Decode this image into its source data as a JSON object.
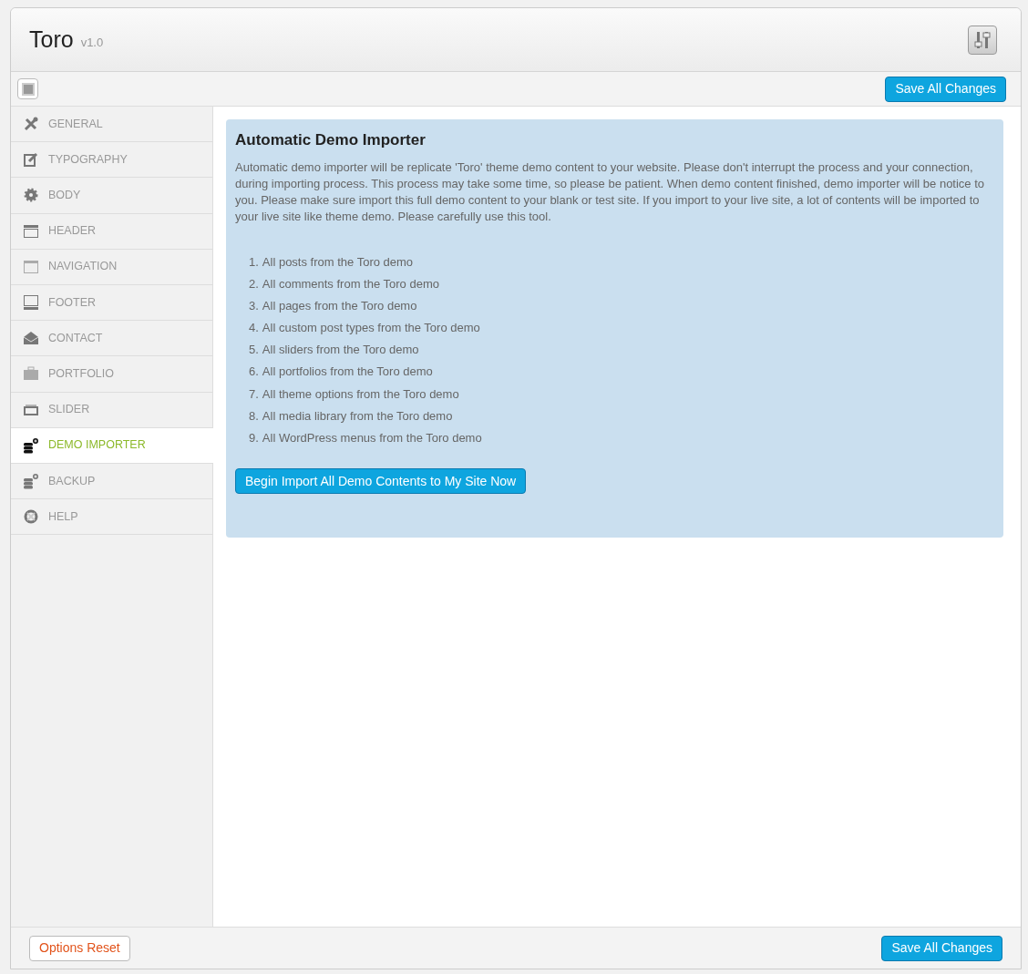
{
  "header": {
    "title": "Toro",
    "version": "v1.0"
  },
  "toolbar": {
    "save_button": "Save All Changes"
  },
  "sidebar": {
    "items": [
      {
        "label": "GENERAL",
        "selected": false
      },
      {
        "label": "TYPOGRAPHY",
        "selected": false
      },
      {
        "label": "BODY",
        "selected": false
      },
      {
        "label": "HEADER",
        "selected": false
      },
      {
        "label": "NAVIGATION",
        "selected": false
      },
      {
        "label": "FOOTER",
        "selected": false
      },
      {
        "label": "CONTACT",
        "selected": false
      },
      {
        "label": "PORTFOLIO",
        "selected": false
      },
      {
        "label": "SLIDER",
        "selected": false
      },
      {
        "label": "DEMO IMPORTER",
        "selected": true
      },
      {
        "label": "BACKUP",
        "selected": false
      },
      {
        "label": "HELP",
        "selected": false
      }
    ]
  },
  "panel": {
    "title": "Automatic Demo Importer",
    "description": "Automatic demo importer will be replicate 'Toro' theme demo content to your website. Please don't interrupt the process and your connection, during importing process. This process may take some time, so please be patient. When demo content finished, demo importer will be notice to you. Please make sure import this full demo content to your blank or test site. If you import to your live site, a lot of contents will be imported to your live site like theme demo. Please carefully use this tool.",
    "list": [
      {
        "number": "1.",
        "text": "All posts from the Toro demo"
      },
      {
        "number": "2.",
        "text": "All comments from the Toro demo"
      },
      {
        "number": "3.",
        "text": "All pages from the Toro demo"
      },
      {
        "number": "4.",
        "text": "All custom post types from the Toro demo"
      },
      {
        "number": "5.",
        "text": "All sliders from the Toro demo"
      },
      {
        "number": "6.",
        "text": "All portfolios from the Toro demo"
      },
      {
        "number": "7.",
        "text": "All theme options from the Toro demo"
      },
      {
        "number": "8.",
        "text": "All media library from the Toro demo"
      },
      {
        "number": "9.",
        "text": "All WordPress menus from the Toro demo"
      }
    ],
    "import_button": "Begin Import All Demo Contents to My Site Now"
  },
  "footer": {
    "reset_button": "Options Reset",
    "save_button": "Save All Changes"
  }
}
